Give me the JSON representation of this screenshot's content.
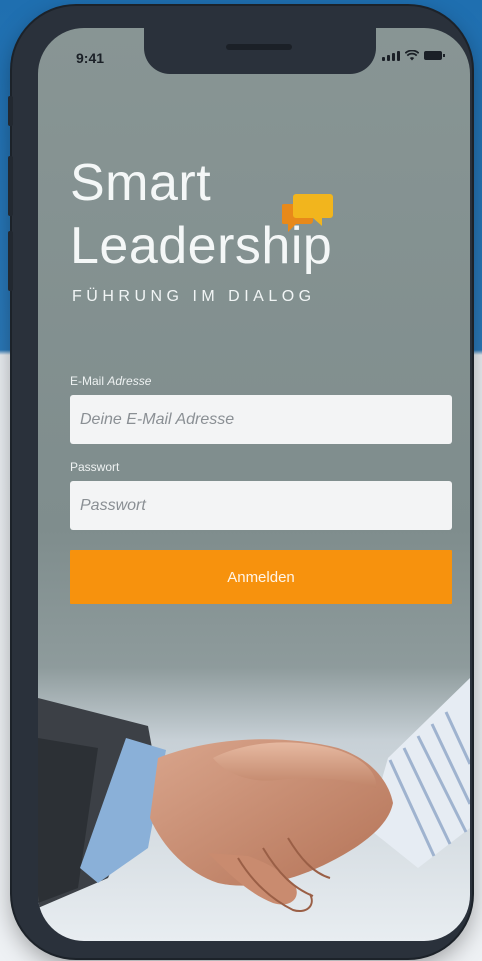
{
  "status_bar": {
    "time": "9:41"
  },
  "branding": {
    "title_line1": "Smart",
    "title_line2": "Leadership",
    "tagline": "FÜHRUNG IM DIALOG",
    "bubble_colors": {
      "front": "#f2b51d",
      "back": "#e8891a"
    }
  },
  "login": {
    "email_label_plain": "E-Mail ",
    "email_label_italic": "Adresse",
    "email_placeholder": "Deine E-Mail Adresse",
    "password_label": "Passwort",
    "password_placeholder": "Passwort",
    "submit_label": "Anmelden"
  },
  "colors": {
    "accent": "#f7920d",
    "screen_bg": "#849191"
  }
}
